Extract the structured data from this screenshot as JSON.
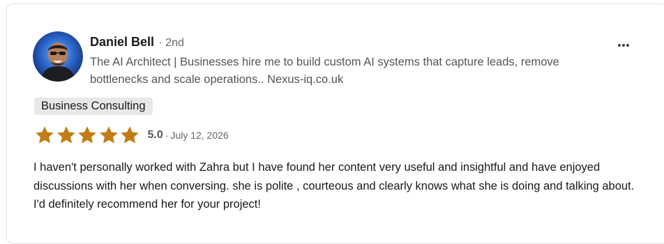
{
  "reviewer": {
    "name": "Daniel Bell",
    "degree": "· 2nd",
    "headline": " The AI Architect | Businesses hire me to build custom AI systems that capture leads, remove bottlenecks and scale operations.. Nexus-iq.co.uk"
  },
  "more_menu": {
    "icon": "ellipsis-horizontal-icon"
  },
  "service_tag": "Business Consulting",
  "rating": {
    "value": "5.0",
    "stars_filled": 5,
    "stars_total": 5,
    "separator": "·",
    "date": "July 12, 2026",
    "star_color": "#c37d16"
  },
  "review_text": "I haven't personally worked with Zahra but I have found her content very useful and insightful and have enjoyed discussions with her when conversing. she is polite , courteous and clearly knows what she is doing and talking about. I'd definitely recommend her for your project!"
}
